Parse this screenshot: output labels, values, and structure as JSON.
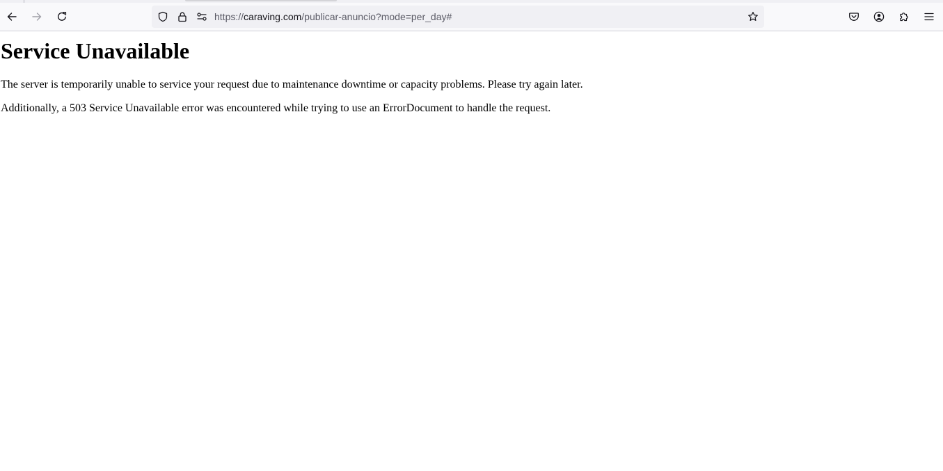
{
  "browser": {
    "url": {
      "scheme": "https://",
      "host": "caraving.com",
      "path": "/publicar-anuncio?mode=per_day#"
    },
    "icons": {
      "back": "arrow-left-icon",
      "forward": "arrow-right-icon",
      "reload": "reload-icon",
      "tracking_protection": "shield-icon",
      "secure": "lock-icon",
      "permissions": "permissions-icon",
      "bookmark": "star-icon",
      "pocket": "pocket-icon",
      "account": "account-icon",
      "extensions": "puzzle-icon",
      "menu": "hamburger-icon"
    },
    "colors": {
      "toolbar": "#f9f9fb",
      "urlbar": "#f0f0f4",
      "icon": "#15141a",
      "disabled_icon": "#a0a0a8"
    }
  },
  "page": {
    "heading": "Service Unavailable",
    "paragraph_1": "The server is temporarily unable to service your request due to maintenance downtime or capacity problems. Please try again later.",
    "paragraph_2": "Additionally, a 503 Service Unavailable error was encountered while trying to use an ErrorDocument to handle the request."
  }
}
